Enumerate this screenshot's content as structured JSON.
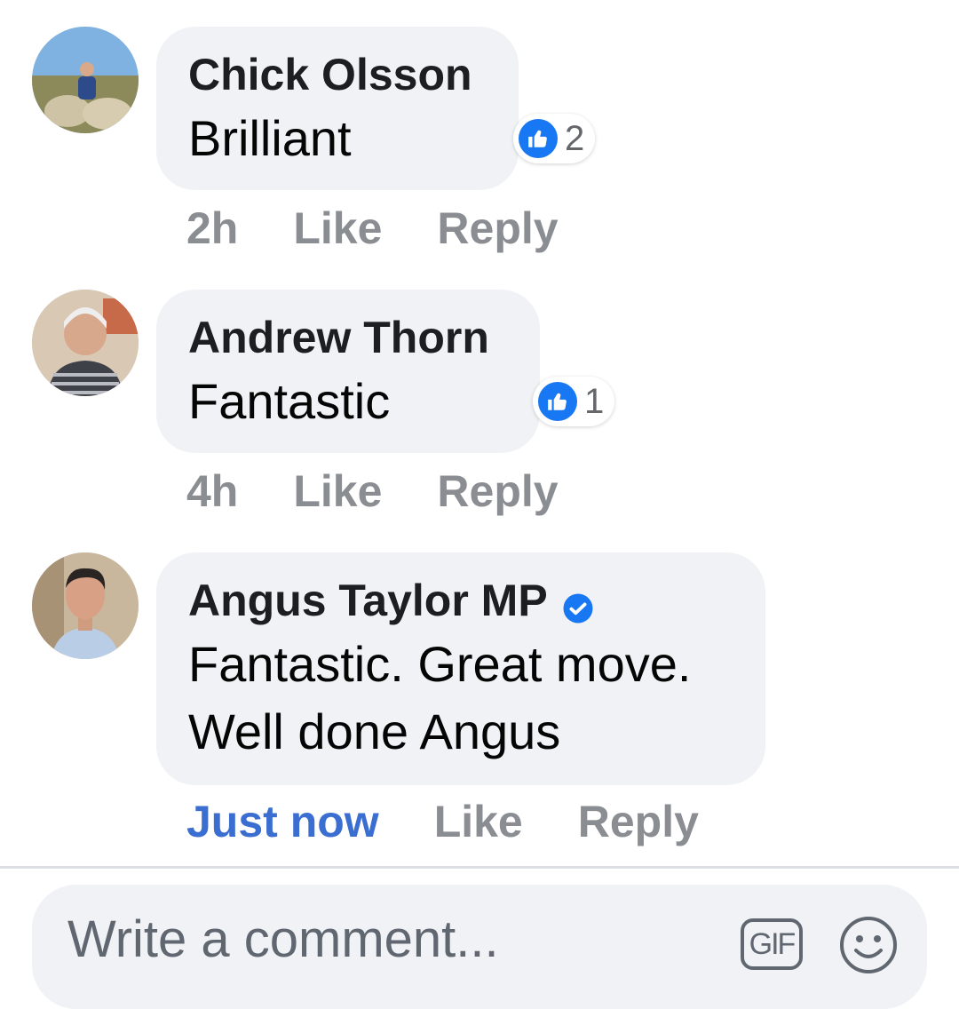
{
  "comments": [
    {
      "author": "Chick Olsson",
      "text": "Brilliant",
      "reaction_count": "2",
      "time": "2h",
      "like_label": "Like",
      "reply_label": "Reply"
    },
    {
      "author": "Andrew Thorn",
      "text": "Fantastic",
      "reaction_count": "1",
      "time": "4h",
      "like_label": "Like",
      "reply_label": "Reply"
    },
    {
      "author": "Angus Taylor MP",
      "verified": true,
      "text_line1": "Fantastic. Great move.",
      "text_line2": "Well done Angus",
      "time": "Just now",
      "like_label": "Like",
      "reply_label": "Reply"
    }
  ],
  "composer": {
    "placeholder": "Write a comment...",
    "gif_label": "GIF",
    "emoji_icon": "smiley-icon"
  },
  "colors": {
    "accent": "#1877f2",
    "time_now": "#3b6ed1",
    "muted": "#8a8d91",
    "bubble": "#f0f2f5"
  }
}
